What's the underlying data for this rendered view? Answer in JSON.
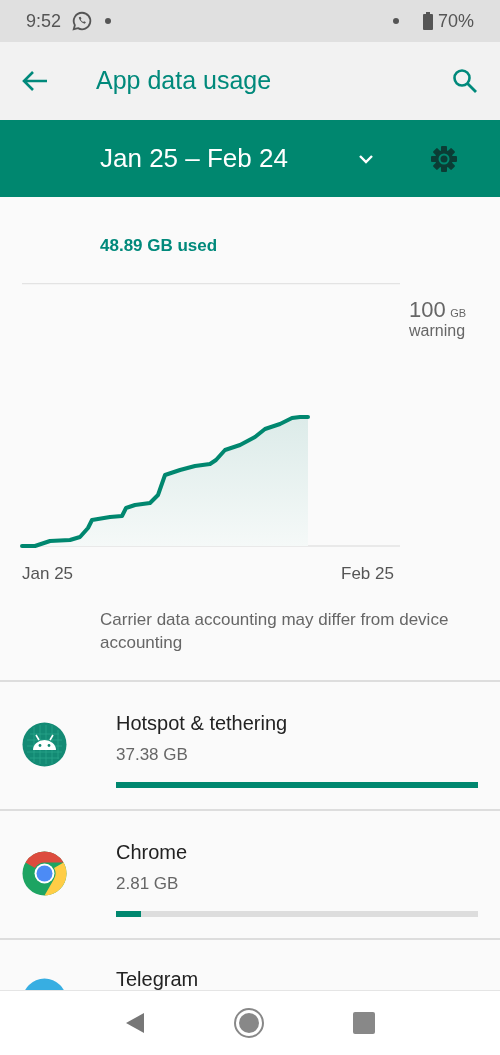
{
  "status_bar": {
    "time": "9:52",
    "battery": "70%"
  },
  "toolbar": {
    "title": "App data usage"
  },
  "period": {
    "label": "Jan 25 – Feb 24"
  },
  "usage": {
    "summary": "48.89 GB used"
  },
  "chart": {
    "warning_value": "100",
    "warning_unit": "GB",
    "warning_label": "warning",
    "start_label": "Jan 25",
    "end_label": "Feb 25"
  },
  "note": "Carrier data accounting may differ from device accounting",
  "apps": [
    {
      "kind": "android",
      "name": "Hotspot & tethering",
      "usage": "37.38 GB",
      "level": 1.0
    },
    {
      "kind": "chrome",
      "name": "Chrome",
      "usage": "2.81 GB",
      "level": 0.07
    },
    {
      "kind": "telegram",
      "name": "Telegram"
    }
  ]
}
